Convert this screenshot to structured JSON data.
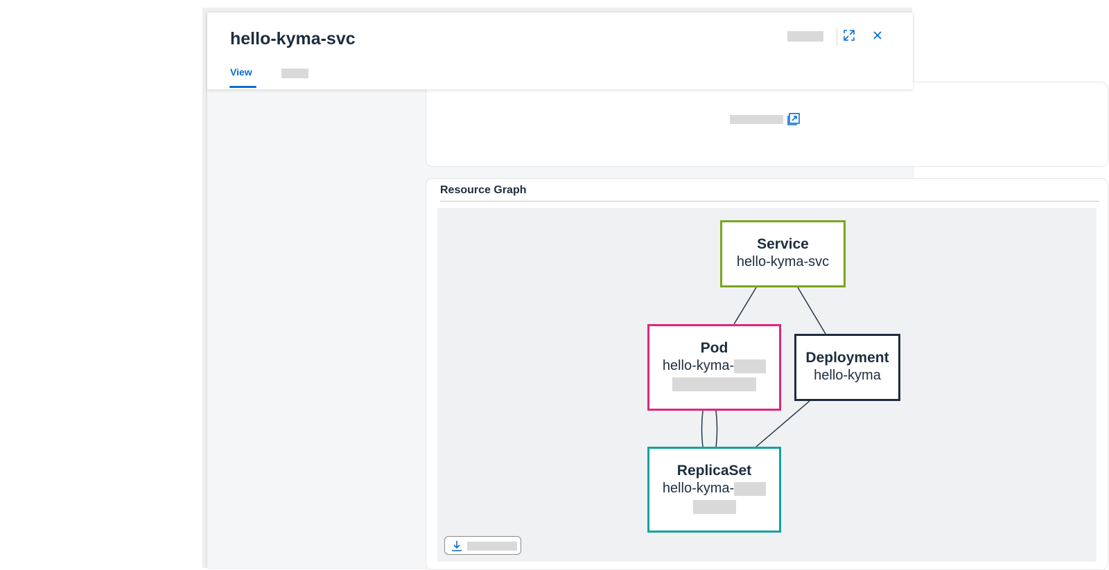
{
  "dialog": {
    "title": "hello-kyma-svc",
    "tabs": [
      {
        "label": "View",
        "active": true
      }
    ]
  },
  "resource_graph": {
    "title": "Resource Graph",
    "nodes": [
      {
        "kind": "Service",
        "name": "hello-kyma-svc",
        "color": "#7aa51b"
      },
      {
        "kind": "Pod",
        "name": "hello-kyma-",
        "color": "#e0267a"
      },
      {
        "kind": "Deployment",
        "name": "hello-kyma",
        "color": "#1d2d3e"
      },
      {
        "kind": "ReplicaSet",
        "name": "hello-kyma-",
        "color": "#14a1a1"
      }
    ]
  },
  "icons": {
    "expand": "expand-icon",
    "close": "close-icon",
    "external_link": "external-link-icon",
    "download": "download-icon"
  },
  "colors": {
    "accent": "#0a6ed1",
    "text": "#1d2d3e",
    "graph_bg": "#eff1f3"
  }
}
